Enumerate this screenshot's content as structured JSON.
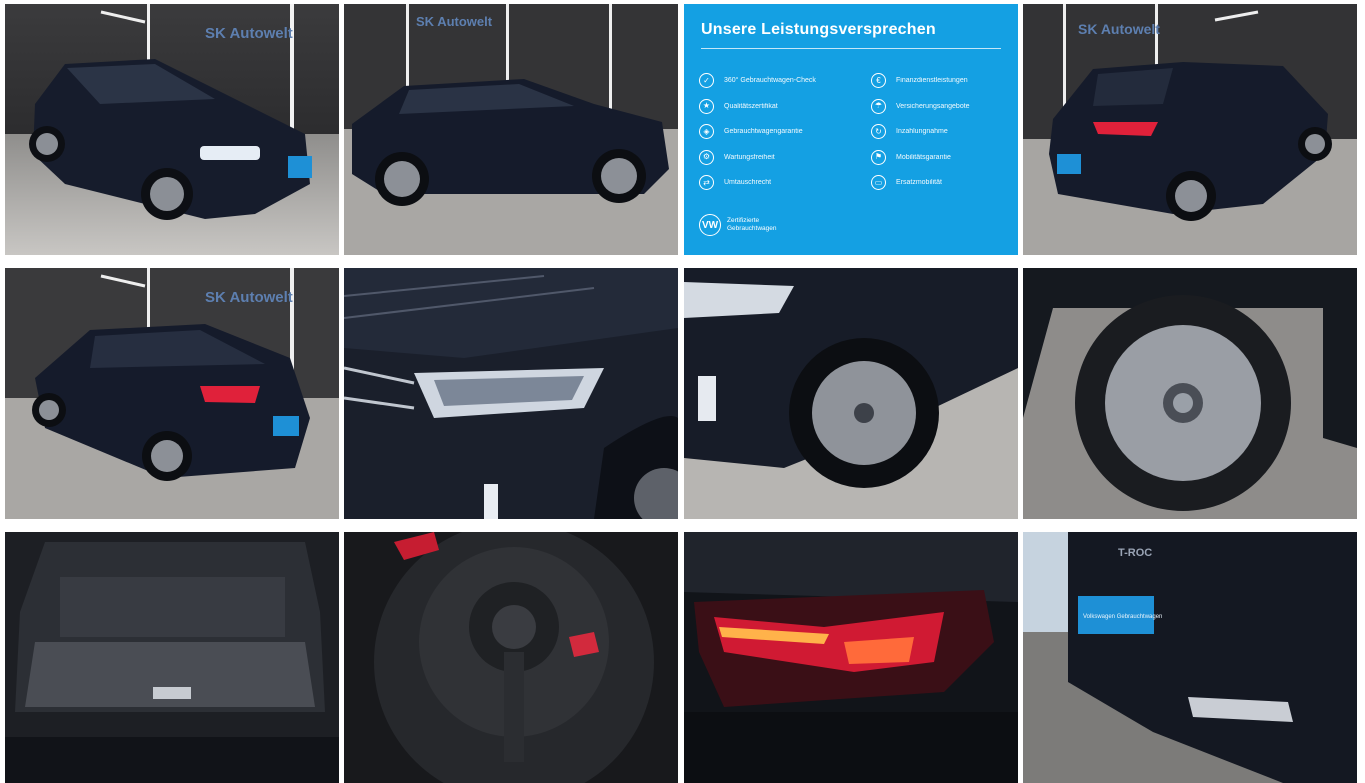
{
  "showroom_logo": "SK Autowelt",
  "promo": {
    "title": "Unsere Leistungsversprechen",
    "left_items": [
      {
        "icon": "check-icon",
        "label": "360° Gebrauchtwagen-Check"
      },
      {
        "icon": "certificate-icon",
        "label": "Qualitätszertifikat"
      },
      {
        "icon": "shield-icon",
        "label": "Gebrauchtwagengarantie"
      },
      {
        "icon": "wrench-icon",
        "label": "Wartungsfreiheit"
      },
      {
        "icon": "exchange-icon",
        "label": "Umtauschrecht"
      }
    ],
    "right_items": [
      {
        "icon": "finance-icon",
        "label": "Finanzdienstleistungen"
      },
      {
        "icon": "insurance-icon",
        "label": "Versicherungsangebote"
      },
      {
        "icon": "trade-in-icon",
        "label": "Inzahlungnahme"
      },
      {
        "icon": "mobility-icon",
        "label": "Mobilitätsgarantie"
      },
      {
        "icon": "replacement-car-icon",
        "label": "Ersatzmobilität"
      }
    ],
    "brand_text": "Zertifizierte\nGebrauchtwagen",
    "brand_mark": "VW"
  },
  "plate_label": "Volkswagen Gebrauchtwagen",
  "model_badge": "T-ROC",
  "colors": {
    "promo_bg": "#14a0e3",
    "car_body": "#151b2b",
    "taillight": "#e0213a",
    "plate": "#1e90d6"
  }
}
